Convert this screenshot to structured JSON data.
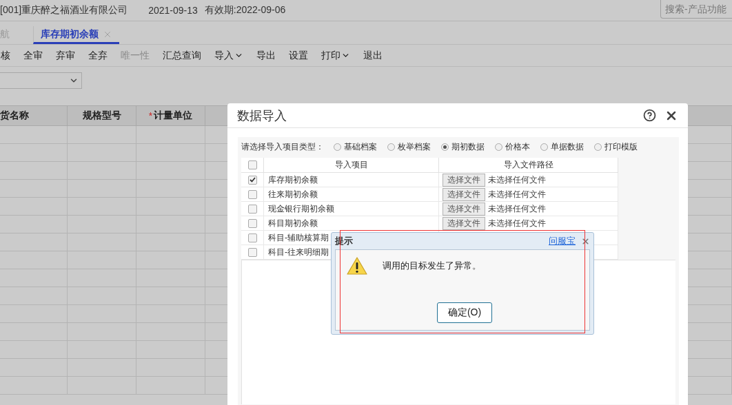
{
  "header": {
    "company": "[001]重庆醉之福酒业有限公司",
    "date": "2021-09-13",
    "validity": "有效期:2022-09-06",
    "search": {
      "placeholder": "搜索-产品功能"
    }
  },
  "tabs": [
    {
      "label": "航",
      "selected": false,
      "closable": false
    },
    {
      "label": "库存期初余额",
      "selected": true,
      "closable": true
    }
  ],
  "toolbar": [
    {
      "label": "核",
      "disabled": false,
      "dropdown": false
    },
    {
      "label": "全审",
      "disabled": false,
      "dropdown": false
    },
    {
      "label": "弃审",
      "disabled": false,
      "dropdown": false
    },
    {
      "label": "全弃",
      "disabled": false,
      "dropdown": false
    },
    {
      "label": "唯一性",
      "disabled": true,
      "dropdown": false
    },
    {
      "label": "汇总查询",
      "disabled": false,
      "dropdown": false
    },
    {
      "label": "导入",
      "disabled": false,
      "dropdown": true
    },
    {
      "label": "导出",
      "disabled": false,
      "dropdown": false
    },
    {
      "label": "设置",
      "disabled": false,
      "dropdown": false
    },
    {
      "label": "打印",
      "disabled": false,
      "dropdown": true
    },
    {
      "label": "退出",
      "disabled": false,
      "dropdown": false
    }
  ],
  "grid": {
    "columns": [
      {
        "label": "货名称"
      },
      {
        "label": "规格型号"
      },
      {
        "label": "计量单位",
        "marker": "*"
      }
    ]
  },
  "dialog": {
    "title": "数据导入",
    "type_label": "请选择导入项目类型：",
    "types": [
      {
        "label": "基础档案",
        "selected": false
      },
      {
        "label": "枚举档案",
        "selected": false
      },
      {
        "label": "期初数据",
        "selected": true
      },
      {
        "label": "价格本",
        "selected": false
      },
      {
        "label": "单据数据",
        "selected": false
      },
      {
        "label": "打印模版",
        "selected": false
      }
    ],
    "all_checked": false,
    "columns": [
      "导入项目",
      "导入文件路径"
    ],
    "items": [
      {
        "name": "库存期初余额",
        "checked": true,
        "button": "选择文件",
        "file": "未选择任何文件"
      },
      {
        "name": "往来期初余额",
        "checked": false,
        "button": "选择文件",
        "file": "未选择任何文件"
      },
      {
        "name": "现金银行期初余额",
        "checked": false,
        "button": "选择文件",
        "file": "未选择任何文件"
      },
      {
        "name": "科目期初余额",
        "checked": false,
        "button": "选择文件",
        "file": "未选择任何文件"
      },
      {
        "name": "科目-辅助核算期",
        "checked": false
      },
      {
        "name": "科目-往来明细期",
        "checked": false
      }
    ]
  },
  "alert": {
    "title": "提示",
    "link": "问服宝",
    "message": "调用的目标发生了异常。",
    "button": "确定(O)"
  }
}
